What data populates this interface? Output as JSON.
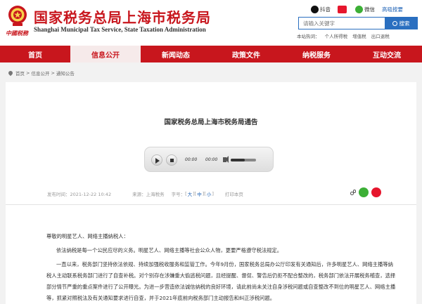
{
  "header": {
    "title": "国家税务总局上海市税务局",
    "subtitle": "Shanghai Municipal Tax Service, State Taxation Administration",
    "brand_mark": "中國税務",
    "social": [
      {
        "label": "抖音"
      },
      {
        "label": "微博"
      },
      {
        "label": "微信"
      }
    ],
    "high_contrast": "高吸按要",
    "search": {
      "placeholder": "请输入关键字",
      "button_label": "搜索"
    },
    "hotwords_label": "本站热词：",
    "hotwords": [
      "个人所得税",
      "增值税",
      "出口退税"
    ]
  },
  "nav": {
    "items": [
      {
        "label": "首页"
      },
      {
        "label": "信息公开",
        "active": true
      },
      {
        "label": "新闻动态"
      },
      {
        "label": "政策文件"
      },
      {
        "label": "纳税服务"
      },
      {
        "label": "互动交流"
      }
    ]
  },
  "breadcrumb": {
    "items": [
      "首页",
      "信息公开",
      "通知公告"
    ]
  },
  "article": {
    "title": "国家税务总局上海市税务局通告",
    "player": {
      "current": "00:00",
      "duration": "00:00",
      "volume_fraction": 0.55
    },
    "meta": {
      "date_label": "发布时间：2021-12-22 10:42",
      "source_label": "来源：上海税务",
      "font_label": "字号：",
      "sizes": [
        "大",
        "中",
        "小"
      ],
      "print_label": "打印本页"
    },
    "paragraphs": [
      "尊敬的明星艺人、网络主播纳税人：",
      "依法纳税是每一个公民应尽的义务。明星艺人、网络主播等社会公众人物，更要严格遵守税法规定。",
      "一直以来，税务部门坚持依法依规、持续加强税收服务和监管工作。今年9月份，国家税务总局办公厅印发有关通知后，许多明星艺人、网络主播等纳税人主动联系税务部门进行了自查补税。对个别存在涉嫌重大偷逃税问题，且经提醒、督促、警告后仍拒不配合整改的，税务部门依法开展税务稽查，选择部分情节严重的重点案件进行了公开曝光。为进一步营造依法诚信纳税的良好环境，请此前尚未关注自身涉税问题或自查整改不到位的明星艺人、网络主播等，抓紧对照税法及有关通知要求进行自查，并于2021年底前向税务部门主动报告和纠正涉税问题。"
    ]
  },
  "colors": {
    "brand_red": "#c8161d",
    "link_blue": "#2a6fc0"
  }
}
